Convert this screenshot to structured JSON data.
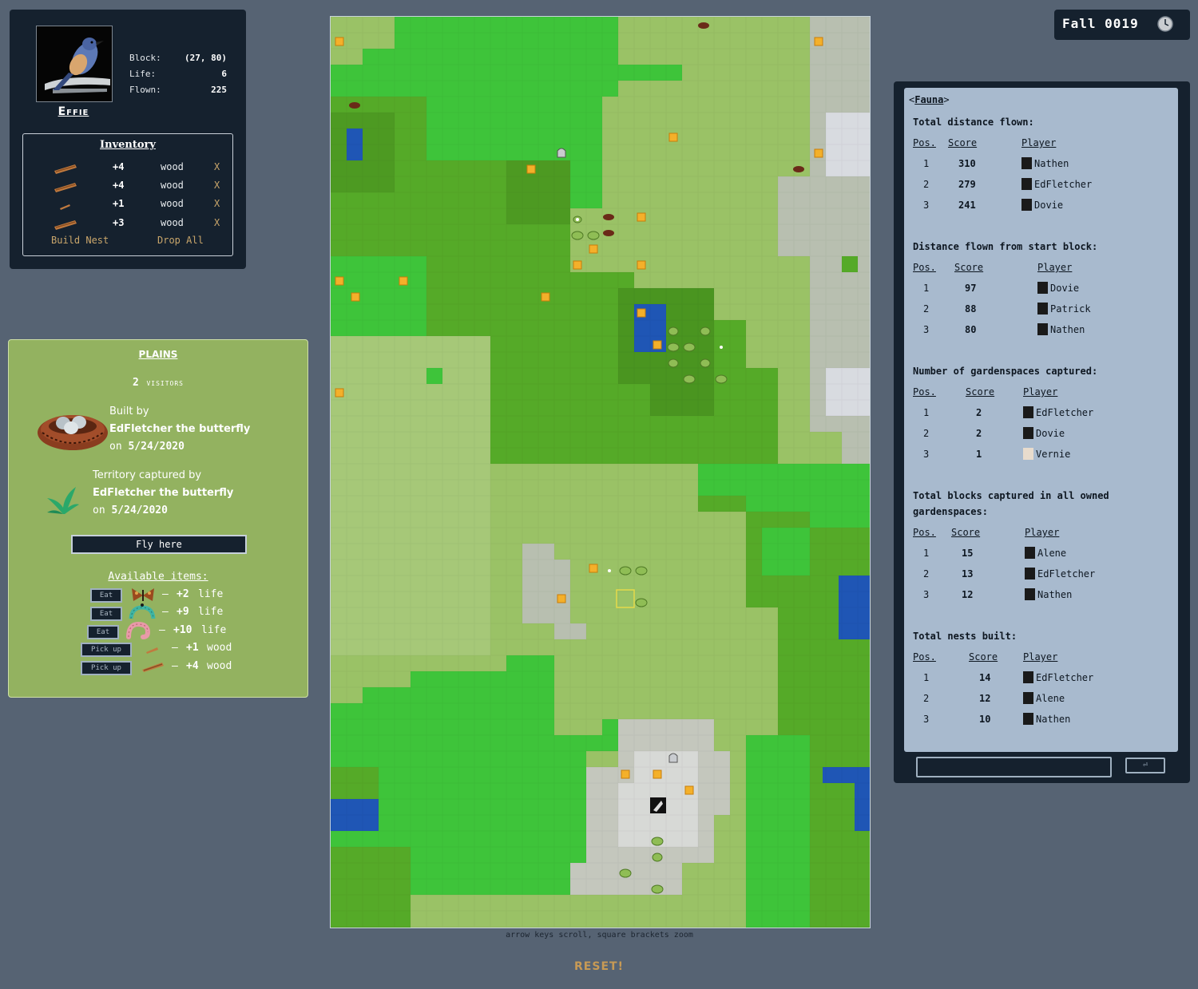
{
  "player": {
    "name": "Effie",
    "stats": [
      {
        "label": "Block:",
        "value": "(27, 80)"
      },
      {
        "label": "Life:",
        "value": "6"
      },
      {
        "label": "Flown:",
        "value": "225"
      }
    ]
  },
  "inventory": {
    "title": "Inventory",
    "items": [
      {
        "amount": "+4",
        "item": "wood",
        "remove": "X"
      },
      {
        "amount": "+4",
        "item": "wood",
        "remove": "X"
      },
      {
        "amount": "+1",
        "item": "wood",
        "remove": "X"
      },
      {
        "amount": "+3",
        "item": "wood",
        "remove": "X"
      }
    ],
    "build_nest": "Build Nest",
    "drop_all": "Drop All"
  },
  "location": {
    "biome": "PLAINS",
    "visitors_count": "2",
    "visitors_label": "visitors",
    "built_by_label": "Built by",
    "built_by": "EdFletcher the butterfly",
    "built_on_label": "on",
    "built_on": "5/24/2020",
    "territory_label": "Territory captured by",
    "territory_by": "EdFletcher the butterfly",
    "territory_on_label": "on",
    "territory_on": "5/24/2020",
    "fly_button": "Fly here",
    "available_title": "Available items:",
    "available": [
      {
        "action": "Eat",
        "icon": "moth-icon",
        "dash": "—",
        "amount": "+2",
        "unit": "life"
      },
      {
        "action": "Eat",
        "icon": "caterpillar-icon",
        "dash": "—",
        "amount": "+9",
        "unit": "life"
      },
      {
        "action": "Eat",
        "icon": "worm-icon",
        "dash": "—",
        "amount": "+10",
        "unit": "life"
      },
      {
        "action": "Pick up",
        "icon": "stick-icon",
        "dash": "—",
        "amount": "+1",
        "unit": "wood"
      },
      {
        "action": "Pick up",
        "icon": "stick-icon",
        "dash": "—",
        "amount": "+4",
        "unit": "wood"
      }
    ]
  },
  "map": {
    "hint": "arrow keys scroll, square brackets zoom",
    "reset": "RESET!"
  },
  "season": {
    "label": "Fall 0019"
  },
  "leaderboard": {
    "tab_open": "<",
    "tab": "Fauna",
    "tab_close": ">",
    "headers": {
      "pos": "Pos.",
      "score": "Score",
      "player": "Player"
    },
    "sections": [
      {
        "title": "Total distance flown:",
        "rows": [
          {
            "pos": "1",
            "score": "310",
            "player": "Nathen"
          },
          {
            "pos": "2",
            "score": "279",
            "player": "EdFletcher"
          },
          {
            "pos": "3",
            "score": "241",
            "player": "Dovie"
          }
        ]
      },
      {
        "title": "Distance flown from start block:",
        "rows": [
          {
            "pos": "1",
            "score": "97",
            "player": "Dovie"
          },
          {
            "pos": "2",
            "score": "88",
            "player": "Patrick"
          },
          {
            "pos": "3",
            "score": "80",
            "player": "Nathen"
          }
        ]
      },
      {
        "title": "Number of gardenspaces captured:",
        "rows": [
          {
            "pos": "1",
            "score": "2",
            "player": "EdFletcher"
          },
          {
            "pos": "2",
            "score": "2",
            "player": "Dovie"
          },
          {
            "pos": "3",
            "score": "1",
            "player": "Vernie"
          }
        ]
      },
      {
        "title": "Total blocks captured in all owned",
        "title2": "gardenspaces:",
        "rows": [
          {
            "pos": "1",
            "score": "15",
            "player": "Alene"
          },
          {
            "pos": "2",
            "score": "13",
            "player": "EdFletcher"
          },
          {
            "pos": "3",
            "score": "12",
            "player": "Nathen"
          }
        ]
      },
      {
        "title": "Total nests built:",
        "rows": [
          {
            "pos": "1",
            "score": "14",
            "player": "EdFletcher"
          },
          {
            "pos": "2",
            "score": "12",
            "player": "Alene"
          },
          {
            "pos": "3",
            "score": "10",
            "player": "Nathen"
          }
        ]
      }
    ],
    "send_icon": "⏎"
  },
  "colors": {
    "background": "#566373",
    "panel": "#15212e",
    "plains_panel": "#93b260",
    "board": "#a8bace",
    "accent_link": "#c9a66b",
    "reset": "#c79a55"
  }
}
